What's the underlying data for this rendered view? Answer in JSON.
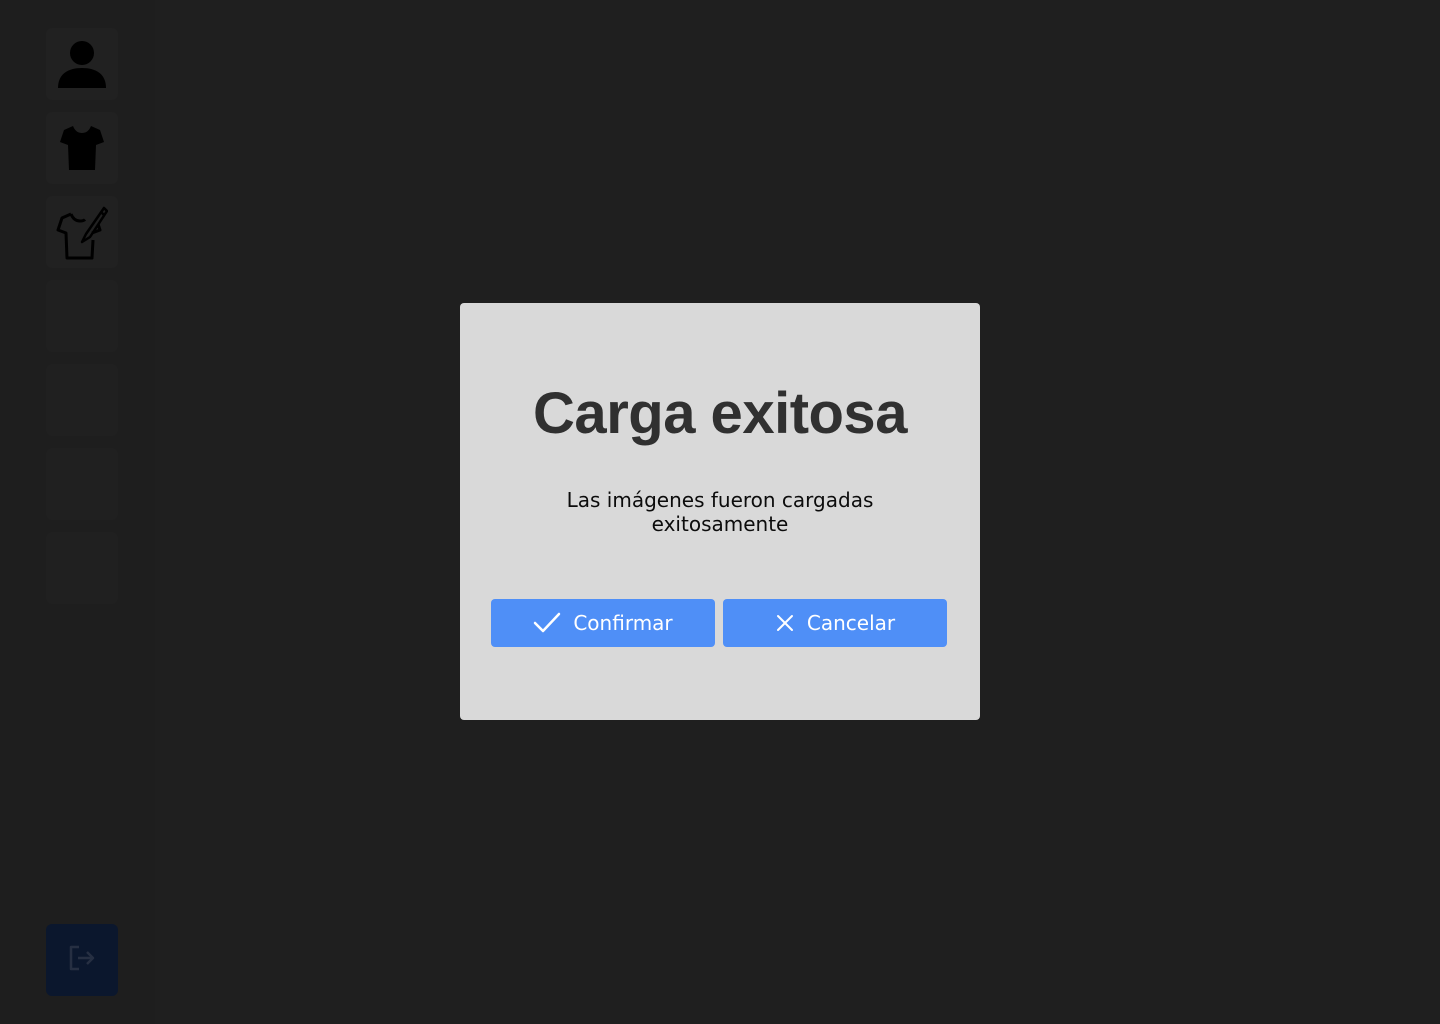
{
  "sidebar": {
    "items": [
      {
        "icon": "user-icon"
      },
      {
        "icon": "tshirt-icon"
      },
      {
        "icon": "tshirt-edit-icon"
      },
      {
        "icon": ""
      },
      {
        "icon": ""
      },
      {
        "icon": ""
      },
      {
        "icon": ""
      }
    ],
    "logout_icon": "logout-icon"
  },
  "modal": {
    "title": "Carga exitosa",
    "message": "Las imágenes fueron cargadas exitosamente",
    "confirm_label": "Confirmar",
    "cancel_label": "Cancelar",
    "confirm_icon": "check-icon",
    "cancel_icon": "x-icon"
  },
  "colors": {
    "background": "#222222",
    "modal_bg": "#d9d9d9",
    "button_accent": "#4f8ff7",
    "title_text": "#303030",
    "logout_bg": "#0d1931"
  }
}
